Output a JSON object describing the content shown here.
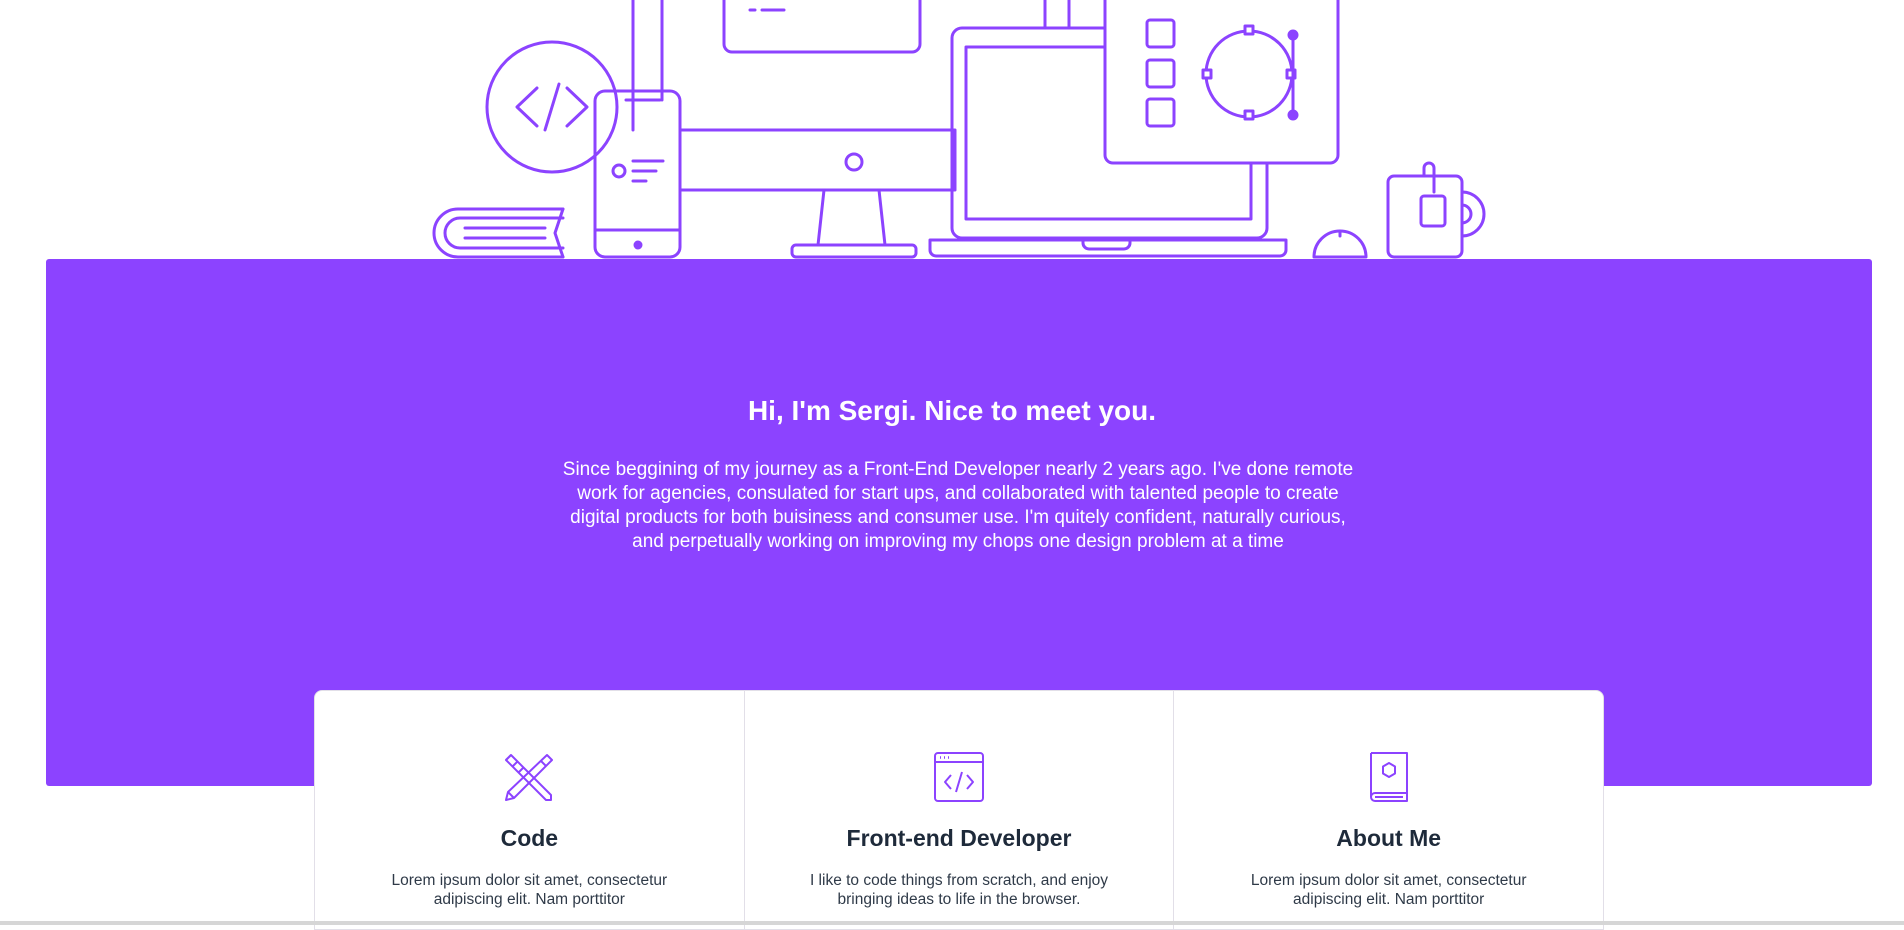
{
  "colors": {
    "accent": "#8c43ff",
    "background": "#ffffff",
    "heading": "#1e2a3a",
    "body_text": "#2f3a48"
  },
  "about": {
    "title": "Hi, I'm Sergi. Nice to meet you.",
    "text": "Since beggining of my journey as a Front-End Developer nearly 2 years ago. I've done remote work for agencies, consulated for start ups, and collaborated with talented people to create digital products for both buisiness and consumer use. I'm quitely confident, naturally curious, and perpetually working on improving my chops one design problem at a time"
  },
  "cards": [
    {
      "icon": "pencil-ruler-icon",
      "title": "Code",
      "text": "Lorem ipsum dolor sit amet, consectetur adipiscing elit. Nam porttitor"
    },
    {
      "icon": "code-window-icon",
      "title": "Front-end Developer",
      "text": "I like to code things from scratch, and enjoy bringing ideas to life in the browser."
    },
    {
      "icon": "book-icon",
      "title": "About Me",
      "text": "Lorem ipsum dolor sit amet, consectetur adipiscing elit. Nam porttitor"
    }
  ]
}
